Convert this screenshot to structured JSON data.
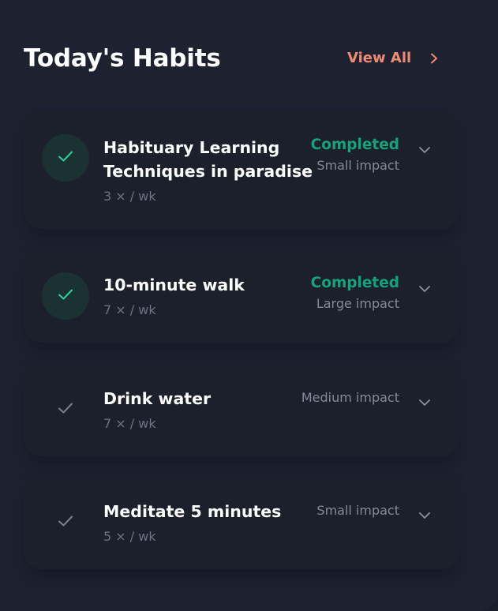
{
  "header": {
    "title": "Today's Habits",
    "view_all_label": "View All"
  },
  "colors": {
    "accent": "#ef8b73",
    "completed": "#16a37a",
    "check_done": "#2fcf9a",
    "check_todo": "#7a8090"
  },
  "habits": [
    {
      "name": "Habituary Learning Techniques in paradise",
      "frequency": "3 × / wk",
      "status": "Completed",
      "impact": "Small impact",
      "completed": true
    },
    {
      "name": "10-minute walk",
      "frequency": "7 × / wk",
      "status": "Completed",
      "impact": "Large impact",
      "completed": true
    },
    {
      "name": "Drink water",
      "frequency": "7 × / wk",
      "status": "",
      "impact": "Medium impact",
      "completed": false
    },
    {
      "name": "Meditate 5 minutes",
      "frequency": "5 × / wk",
      "status": "",
      "impact": "Small impact",
      "completed": false
    }
  ]
}
